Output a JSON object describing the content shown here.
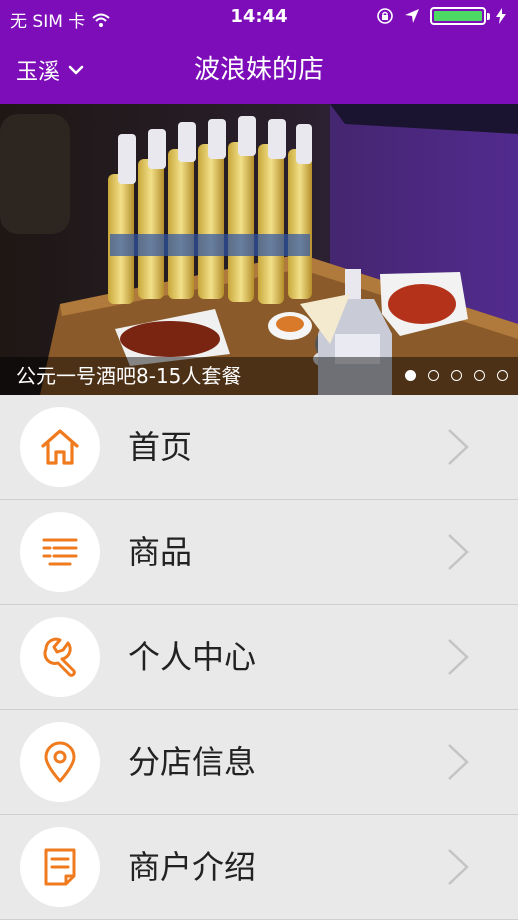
{
  "status_bar": {
    "carrier": "无 SIM 卡",
    "time": "14:44"
  },
  "nav": {
    "city": "玉溪",
    "title": "波浪妹的店"
  },
  "banner": {
    "caption": "公元一号酒吧8-15人套餐",
    "slide_count": 5,
    "active_slide": 1
  },
  "menu": {
    "items": [
      {
        "label": "首页",
        "icon": "home-icon"
      },
      {
        "label": "商品",
        "icon": "list-icon"
      },
      {
        "label": "个人中心",
        "icon": "wrench-icon"
      },
      {
        "label": "分店信息",
        "icon": "location-pin-icon"
      },
      {
        "label": "商户介绍",
        "icon": "document-icon"
      }
    ]
  },
  "colors": {
    "brand_purple": "#7d0db8",
    "accent_orange": "#f07b1e",
    "background": "#e9e9e9"
  }
}
